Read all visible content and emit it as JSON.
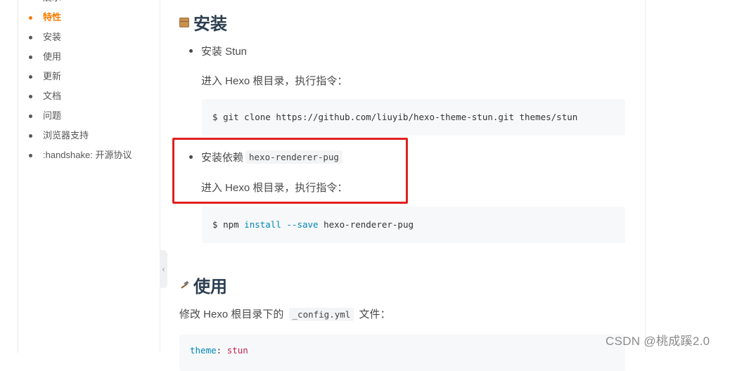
{
  "sidebar": {
    "items": [
      {
        "label": "展示",
        "active": false
      },
      {
        "label": "特性",
        "active": true
      },
      {
        "label": "安装",
        "active": false
      },
      {
        "label": "使用",
        "active": false
      },
      {
        "label": "更新",
        "active": false
      },
      {
        "label": "文档",
        "active": false
      },
      {
        "label": "问题",
        "active": false
      },
      {
        "label": "浏览器支持",
        "active": false
      },
      {
        "label": ":handshake: 开源协议",
        "active": false
      }
    ],
    "collapse_glyph": "‹"
  },
  "install": {
    "heading": "安装",
    "heading_icon": "package-icon",
    "step1_label": "安装 Stun",
    "step1_text": "进入 Hexo 根目录，执行指令：",
    "step1_code_prompt": "$",
    "step1_code": "git clone https://github.com/liuyib/hexo-theme-stun.git themes/stun",
    "step2_label": "安装依赖",
    "step2_pkg": "hexo-renderer-pug",
    "step2_text": "进入 Hexo 根目录，执行指令：",
    "step2_code_prompt": "$",
    "step2_code_cmd": "npm",
    "step2_code_kw": "install",
    "step2_code_flag": "--save",
    "step2_code_pkg": "hexo-renderer-pug"
  },
  "usage": {
    "heading": "使用",
    "heading_icon": "hammer-icon",
    "text_before": "修改 Hexo 根目录下的",
    "file": "_config.yml",
    "text_after": "文件：",
    "code_key": "theme",
    "code_value": "stun"
  },
  "watermark": "CSDN @桃成蹊2.0",
  "colors": {
    "active": "#f57c00",
    "highlight": "#e02020",
    "heading": "#2c3e50"
  }
}
